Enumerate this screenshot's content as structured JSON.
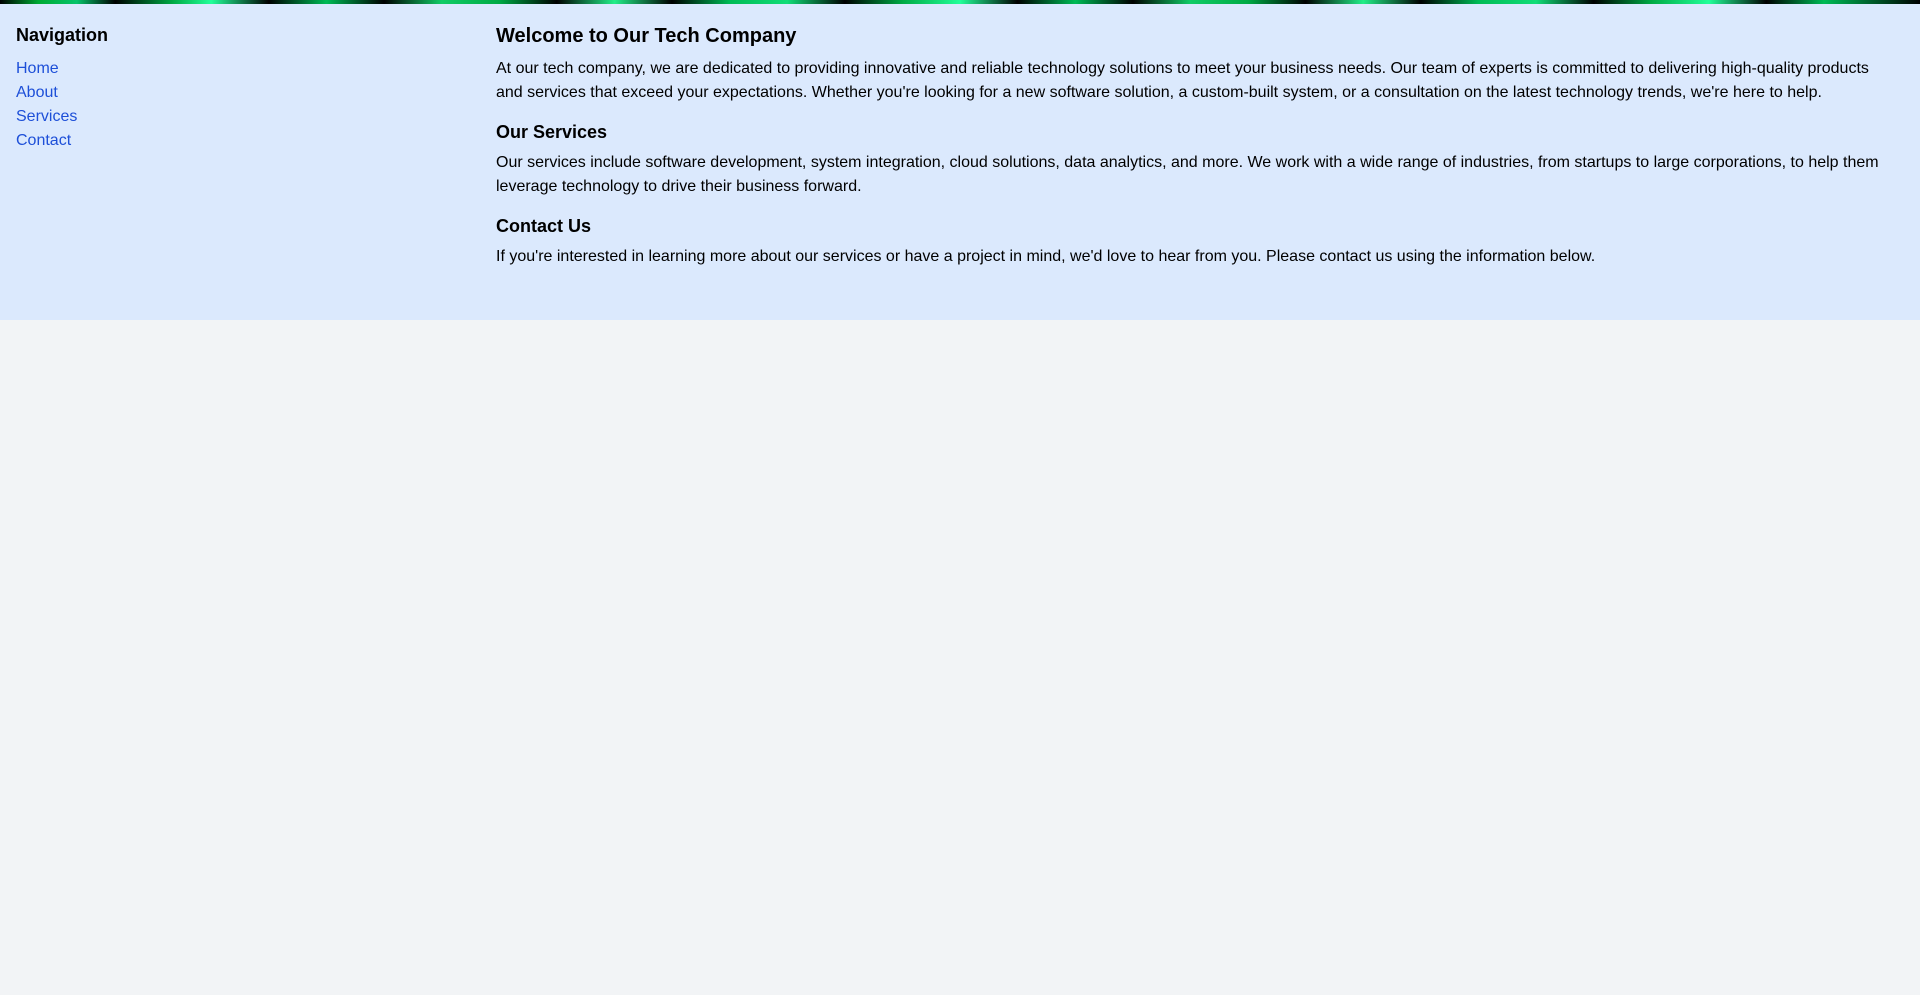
{
  "sidebar": {
    "heading": "Navigation",
    "items": [
      {
        "label": "Home"
      },
      {
        "label": "About"
      },
      {
        "label": "Services"
      },
      {
        "label": "Contact"
      }
    ]
  },
  "main": {
    "title": "Welcome to Our Tech Company",
    "intro": "At our tech company, we are dedicated to providing innovative and reliable technology solutions to meet your business needs. Our team of experts is committed to delivering high-quality products and services that exceed your expectations. Whether you're looking for a new software solution, a custom-built system, or a consultation on the latest technology trends, we're here to help.",
    "sections": [
      {
        "heading": "Our Services",
        "text": "Our services include software development, system integration, cloud solutions, data analytics, and more. We work with a wide range of industries, from startups to large corporations, to help them leverage technology to drive their business forward."
      },
      {
        "heading": "Contact Us",
        "text": "If you're interested in learning more about our services or have a project in mind, we'd love to hear from you. Please contact us using the information below."
      }
    ]
  },
  "colors": {
    "panel_background": "#dbe9fd",
    "page_background": "#f2f4f6",
    "link": "#1d4fd8"
  }
}
